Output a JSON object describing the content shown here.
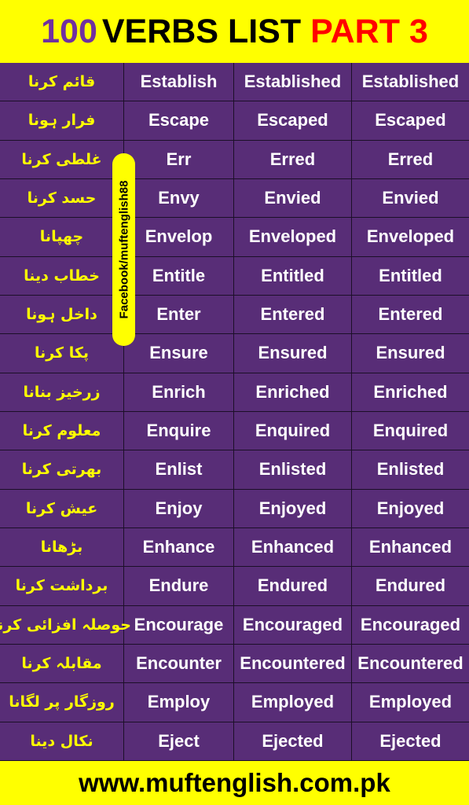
{
  "header": {
    "part1": "100",
    "part2": "VERBS LIST",
    "part3": "PART 3"
  },
  "colors": {
    "background_purple": "#582d77",
    "accent_yellow": "#ffff00",
    "title_purple": "#7030a0",
    "title_red": "#ff0000"
  },
  "facebook_tag": "Facebook/muftenglish88",
  "rows": [
    {
      "urdu": "قائم کرنا",
      "base": "Establish",
      "past": "Established",
      "participle": "Established"
    },
    {
      "urdu": "فرار ہونا",
      "base": "Escape",
      "past": "Escaped",
      "participle": "Escaped"
    },
    {
      "urdu": "غلطی کرنا",
      "base": "Err",
      "past": "Erred",
      "participle": "Erred"
    },
    {
      "urdu": "حسد کرنا",
      "base": "Envy",
      "past": "Envied",
      "participle": "Envied"
    },
    {
      "urdu": "چھپانا",
      "base": "Envelop",
      "past": "Enveloped",
      "participle": "Enveloped"
    },
    {
      "urdu": "خطاب دینا",
      "base": "Entitle",
      "past": "Entitled",
      "participle": "Entitled"
    },
    {
      "urdu": "داخل ہونا",
      "base": "Enter",
      "past": "Entered",
      "participle": "Entered"
    },
    {
      "urdu": "پکا کرنا",
      "base": "Ensure",
      "past": "Ensured",
      "participle": "Ensured"
    },
    {
      "urdu": "زرخیز بنانا",
      "base": "Enrich",
      "past": "Enriched",
      "participle": "Enriched"
    },
    {
      "urdu": "معلوم کرنا",
      "base": "Enquire",
      "past": "Enquired",
      "participle": "Enquired"
    },
    {
      "urdu": "بھرتی کرنا",
      "base": "Enlist",
      "past": "Enlisted",
      "participle": "Enlisted"
    },
    {
      "urdu": "عیش کرنا",
      "base": "Enjoy",
      "past": "Enjoyed",
      "participle": "Enjoyed"
    },
    {
      "urdu": "بڑھانا",
      "base": "Enhance",
      "past": "Enhanced",
      "participle": "Enhanced"
    },
    {
      "urdu": "برداشت کرنا",
      "base": "Endure",
      "past": "Endured",
      "participle": "Endured"
    },
    {
      "urdu": "حوصلہ افزائی کرنا",
      "base": "Encourage",
      "past": "Encouraged",
      "participle": "Encouraged"
    },
    {
      "urdu": "مقابلہ کرنا",
      "base": "Encounter",
      "past": "Encountered",
      "participle": "Encountered"
    },
    {
      "urdu": "روزگار پر لگانا",
      "base": "Employ",
      "past": "Employed",
      "participle": "Employed"
    },
    {
      "urdu": "نکال دینا",
      "base": "Eject",
      "past": "Ejected",
      "participle": "Ejected"
    }
  ],
  "footer": {
    "website": "www.muftenglish.com.pk"
  }
}
